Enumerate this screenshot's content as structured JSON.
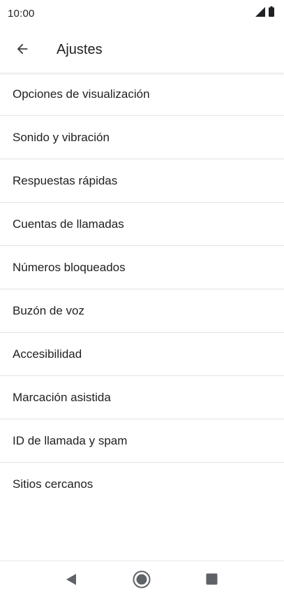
{
  "status_bar": {
    "time": "10:00",
    "icons": [
      "signal-icon",
      "battery-icon"
    ]
  },
  "header": {
    "title": "Ajustes",
    "back_icon": "arrow-back-icon"
  },
  "settings": {
    "items": [
      {
        "label": "Opciones de visualización"
      },
      {
        "label": "Sonido y vibración"
      },
      {
        "label": "Respuestas rápidas"
      },
      {
        "label": "Cuentas de llamadas"
      },
      {
        "label": "Números bloqueados"
      },
      {
        "label": "Buzón de voz"
      },
      {
        "label": "Accesibilidad"
      },
      {
        "label": "Marcación asistida"
      },
      {
        "label": "ID de llamada y spam"
      },
      {
        "label": "Sitios cercanos"
      }
    ]
  },
  "nav_bar": {
    "buttons": [
      "back-triangle-icon",
      "home-circle-icon",
      "recents-square-icon"
    ]
  },
  "colors": {
    "text": "#202124",
    "divider": "#e3e3e3",
    "nav_icon": "#5f6368"
  }
}
